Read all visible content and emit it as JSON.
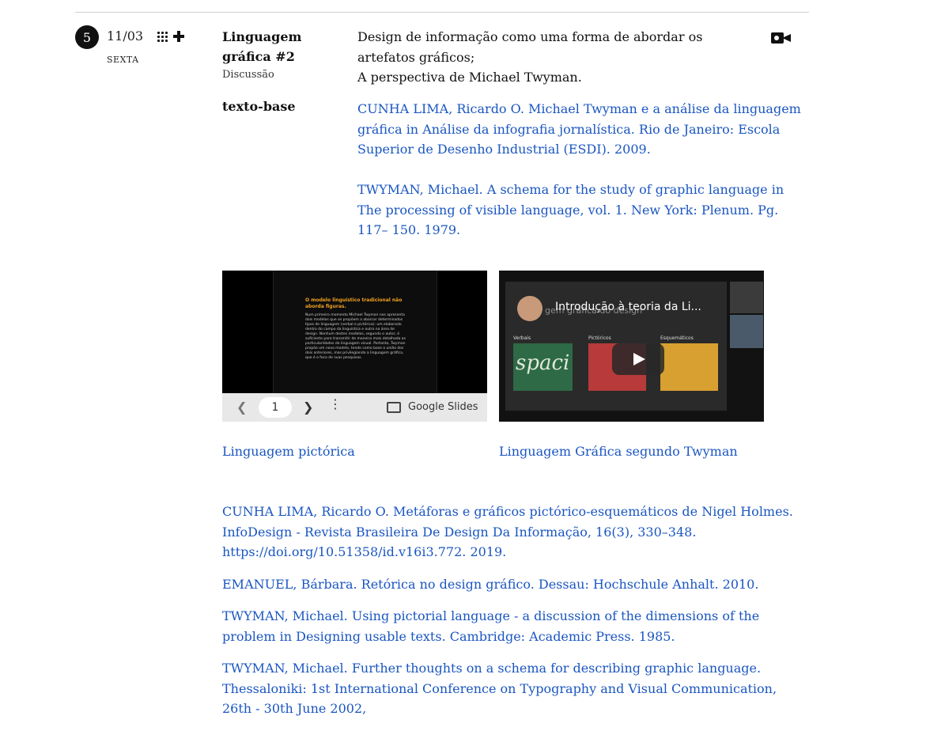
{
  "session": {
    "number": "5",
    "date": "11/03",
    "weekday": "SEXTA",
    "title": "Linguagem gráfica #2",
    "type": "Discussão",
    "description_lines": [
      "Design de informação como uma forma de abordar os artefatos gráficos;",
      "A perspectiva de Michael Twyman."
    ],
    "base_label": "texto-base"
  },
  "base_refs": [
    "CUNHA LIMA, Ricardo O. Michael Twyman e a análise da linguagem gráfica in Análise da infografia jornalística. Rio de Janeiro: Escola Superior de Desenho Industrial (ESDI). 2009.",
    "TWYMAN, Michael. A schema for the study of graphic language in The processing of visible language, vol. 1. New York: Plenum. Pg. 117– 150. 1979."
  ],
  "slides_embed": {
    "slide_title": "O modelo linguístico tradicional não aborda figuras.",
    "slide_text": "Num primeiro momento Michael Twyman nos apresenta dois modelos que se propõem a abarcar determinados tipos de linguagem (verbal e pictórica): um elaborado dentro do campo da linguística e outro na área de design. Nenhum destes modelos, segundo o autor, é suficiente para transmitir de maneira mais detalhada as particularidades da linguagem visual. Portanto, Twyman propõe um novo modelo, tendo como base a união dos dois anteriores, mas privilegiando a linguagem gráfica, que é o foco de suas pesquisas.",
    "prev_icon": "chevron-left-icon",
    "page": "1",
    "next_icon": "chevron-right-icon",
    "menu_icon": "more-vert-icon",
    "brand": "Google Slides",
    "caption": "Linguagem pictórica"
  },
  "video_embed": {
    "title": "Introdução à teoria da Li...",
    "subtitle": "gem gráfica do design",
    "categories": [
      "Verbais",
      "Pictóricos",
      "Esquemáticos"
    ],
    "thumb_word": "spaci",
    "caption": "Linguagem Gráfica segundo Twyman"
  },
  "more_refs": [
    "CUNHA LIMA, Ricardo O. Metáforas e gráficos pictórico-esquemáticos de Nigel Holmes. InfoDesign - Revista Brasileira De Design Da Informação, 16(3), 330–348. https://doi.org/10.51358/id.v16i3.772. 2019.",
    "EMANUEL, Bárbara. Retórica no design gráfico. Dessau: Hochschule Anhalt. 2010.",
    "TWYMAN, Michael. Using pictorial language - a discussion of the dimensions of the problem in Designing usable texts. Cambridge: Academic Press. 1985.",
    "TWYMAN, Michael. Further thoughts on a schema for describing graphic language. Thessaloniki: 1st International Conference on Typography and Visual Communication, 26th - 30th June 2002,"
  ],
  "colors": {
    "link": "#1a56c2",
    "text": "#111111",
    "divider": "#cfcfcf"
  }
}
